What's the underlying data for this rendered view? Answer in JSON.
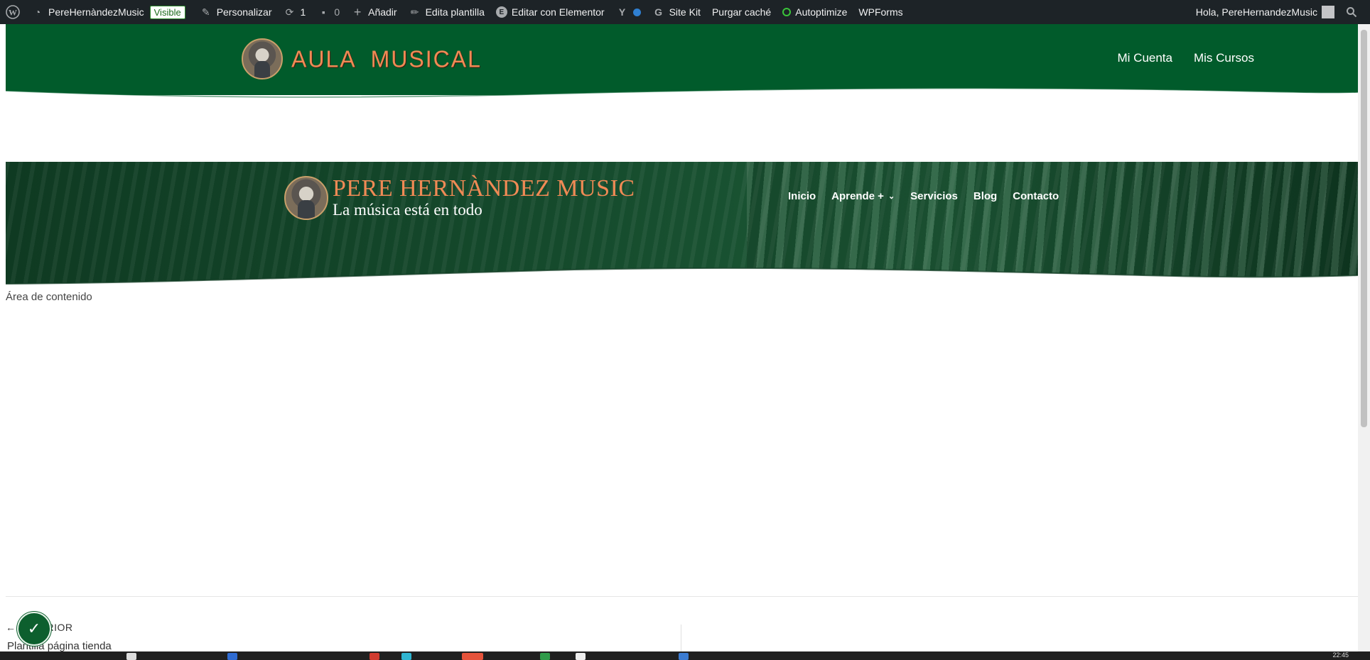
{
  "adminbar": {
    "site_name": "PereHernàndezMusic",
    "visible_badge": "Visible",
    "customize": "Personalizar",
    "updates_count": "1",
    "comments_count": "0",
    "add_new": "Añadir",
    "edit_template": "Edita plantilla",
    "elementor": "Editar con Elementor",
    "site_kit": "Site Kit",
    "purge_cache": "Purgar caché",
    "autoptimize": "Autoptimize",
    "wpforms": "WPForms",
    "greeting": "Hola, PereHernandezMusic"
  },
  "header1": {
    "logo_text": "AULA  MUSICAL",
    "nav": [
      "Mi Cuenta",
      "Mis Cursos"
    ]
  },
  "header2": {
    "logo_title": "PERE HERNÀNDEZ MUSIC",
    "logo_subtitle": "La música está en todo",
    "nav": [
      "Inicio",
      "Aprende +",
      "Servicios",
      "Blog",
      "Contacto"
    ]
  },
  "content": {
    "area_label": "Área de contenido"
  },
  "footer_nav": {
    "prev_label": "← ANTERIOR",
    "prev_title": "Plantilla página tienda"
  },
  "taskbar": {
    "time": "22:45"
  },
  "colors": {
    "header_green": "#015b2b",
    "accent_orange": "#f08a55",
    "adminbar": "#1d2327"
  }
}
